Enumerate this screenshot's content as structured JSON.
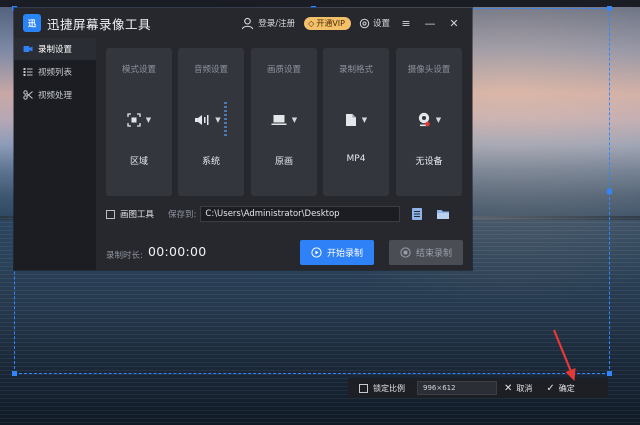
{
  "app": {
    "title": "迅捷屏幕录像工具",
    "logo_text": "迅",
    "login_label": "登录/注册",
    "vip_label": "开通VIP",
    "settings_label": "设置"
  },
  "sidebar": {
    "items": [
      {
        "label": "录制设置",
        "icon": "camera-icon",
        "active": true
      },
      {
        "label": "视频列表",
        "icon": "list-icon",
        "active": false
      },
      {
        "label": "视频处理",
        "icon": "scissors-icon",
        "active": false
      }
    ]
  },
  "cards": [
    {
      "title": "模式设置",
      "value": "区域",
      "icon": "region-select-icon"
    },
    {
      "title": "音频设置",
      "value": "系统",
      "icon": "speaker-icon"
    },
    {
      "title": "画质设置",
      "value": "原画",
      "icon": "laptop-icon"
    },
    {
      "title": "录制格式",
      "value": "MP4",
      "icon": "file-icon"
    },
    {
      "title": "摄像头设置",
      "value": "无设备",
      "icon": "webcam-icon"
    }
  ],
  "path_row": {
    "annotate_label": "画图工具",
    "save_label": "保存到:",
    "path_value": "C:\\Users\\Administrator\\Desktop"
  },
  "recording": {
    "duration_label": "录制时长:",
    "duration_value": "00:00:00",
    "start_label": "开始录制",
    "stop_label": "结束录制"
  },
  "capture_toolbar": {
    "lock_ratio_label": "锁定比例",
    "size_value": "996×612",
    "cancel_label": "取消",
    "confirm_label": "确定"
  },
  "colors": {
    "accent": "#2f81f7",
    "vip": "#f4c06a",
    "selection": "#2f86ff",
    "arrow": "#e53935"
  }
}
